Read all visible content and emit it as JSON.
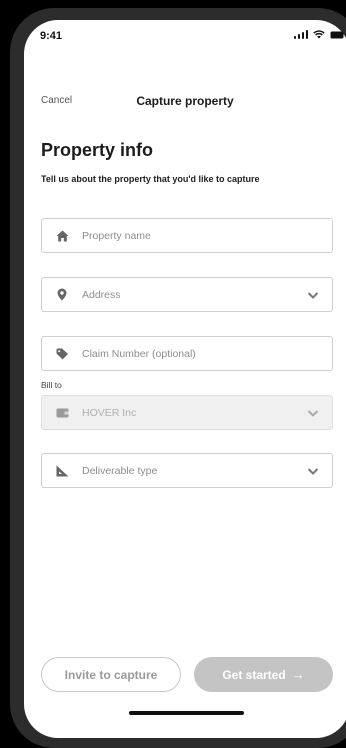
{
  "status": {
    "time": "9:41"
  },
  "nav": {
    "cancel": "Cancel",
    "title": "Capture property"
  },
  "section": {
    "title": "Property info",
    "subtitle": "Tell us about the property that you'd like to capture"
  },
  "fields": {
    "property_name": {
      "placeholder": "Property name",
      "icon": "home-icon"
    },
    "address": {
      "placeholder": "Address",
      "icon": "location-pin-icon"
    },
    "claim_number": {
      "placeholder": "Claim Number (optional)",
      "icon": "tag-icon"
    },
    "bill_to": {
      "label": "Bill to",
      "value": "HOVER Inc",
      "icon": "wallet-icon"
    },
    "deliverable_type": {
      "placeholder": "Deliverable type",
      "icon": "ruler-triangle-icon"
    }
  },
  "actions": {
    "invite": "Invite to capture",
    "start": "Get started",
    "start_arrow": "→"
  },
  "colors": {
    "icon": "#666666",
    "disabled_button": "#c4c4c4"
  }
}
